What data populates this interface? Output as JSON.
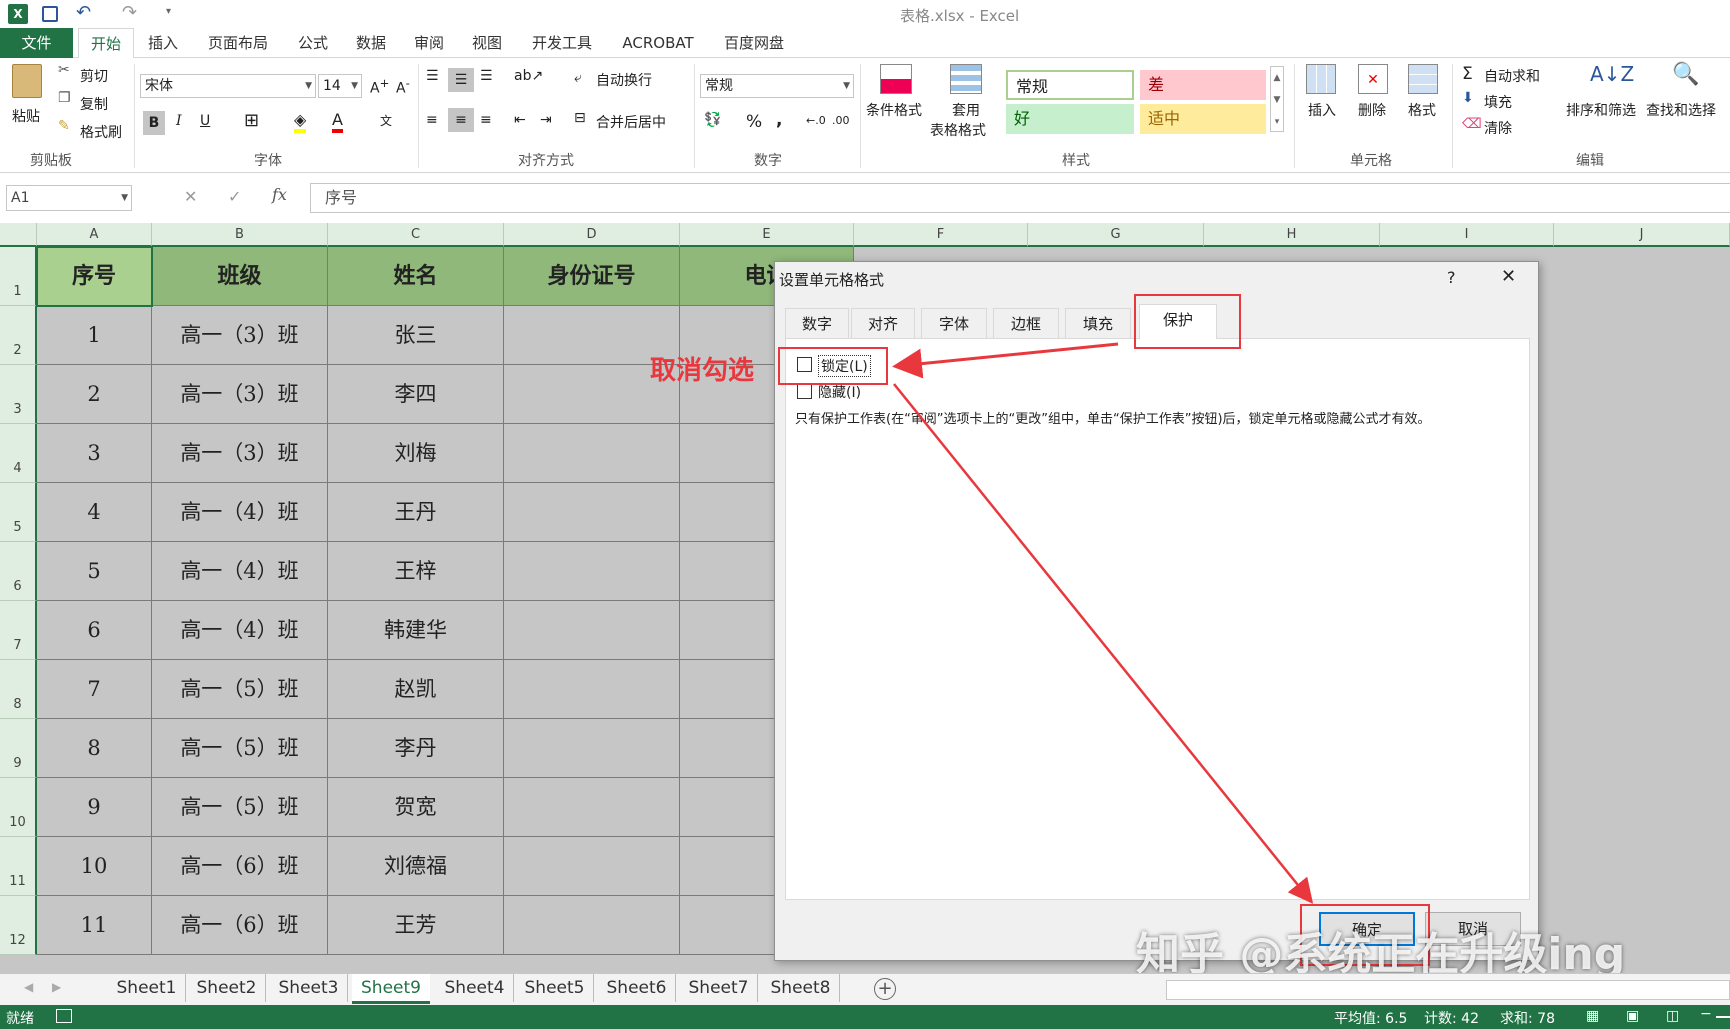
{
  "app": {
    "title": "表格.xlsx - Excel",
    "icon": "excel-icon"
  },
  "quick_access": {
    "save_icon": "save-icon",
    "undo_icon": "undo-icon",
    "redo_icon": "redo-icon"
  },
  "ribbon_tabs": [
    "文件",
    "开始",
    "插入",
    "页面布局",
    "公式",
    "数据",
    "审阅",
    "视图",
    "开发工具",
    "ACROBAT",
    "百度网盘"
  ],
  "active_tab": "开始",
  "clipboard": {
    "paste": "粘贴",
    "cut": "剪切",
    "copy": "复制",
    "format_painter": "格式刷",
    "label": "剪贴板"
  },
  "font": {
    "name": "宋体",
    "size": "14",
    "bold": "B",
    "italic": "I",
    "underline": "U",
    "label": "字体"
  },
  "alignment": {
    "wrap": "自动换行",
    "merge": "合并后居中",
    "label": "对齐方式"
  },
  "number": {
    "format": "常规",
    "percent": "%",
    "comma": ",",
    "label": "数字"
  },
  "styles": {
    "conditional": "条件格式",
    "table_format_1": "套用",
    "table_format_2": "表格格式",
    "normal": "常规",
    "bad": "差",
    "good": "好",
    "neutral": "适中",
    "label": "样式"
  },
  "cells_group": {
    "insert": "插入",
    "delete": "删除",
    "format": "格式",
    "label": "单元格"
  },
  "editing": {
    "autosum": "自动求和",
    "fill": "填充",
    "clear": "清除",
    "sort": "排序和筛选",
    "find": "查找和选择",
    "label": "编辑"
  },
  "formula_bar": {
    "name_box": "A1",
    "fx": "fx",
    "content": "序号"
  },
  "columns": [
    "A",
    "B",
    "C",
    "D",
    "E",
    "F",
    "G",
    "H",
    "I",
    "J"
  ],
  "rows": [
    "1",
    "2",
    "3",
    "4",
    "5",
    "6",
    "7",
    "8",
    "9",
    "10",
    "11",
    "12"
  ],
  "table": {
    "headers": [
      "序号",
      "班级",
      "姓名",
      "身份证号",
      "电话"
    ],
    "rows": [
      [
        "1",
        "高一（3）班",
        "张三"
      ],
      [
        "2",
        "高一（3）班",
        "李四"
      ],
      [
        "3",
        "高一（3）班",
        "刘梅"
      ],
      [
        "4",
        "高一（4）班",
        "王丹"
      ],
      [
        "5",
        "高一（4）班",
        "王梓"
      ],
      [
        "6",
        "高一（4）班",
        "韩建华"
      ],
      [
        "7",
        "高一（5）班",
        "赵凯"
      ],
      [
        "8",
        "高一（5）班",
        "李丹"
      ],
      [
        "9",
        "高一（5）班",
        "贺宽"
      ],
      [
        "10",
        "高一（6）班",
        "刘德福"
      ],
      [
        "11",
        "高一（6）班",
        "王芳"
      ]
    ]
  },
  "sheets": [
    "Sheet1",
    "Sheet2",
    "Sheet3",
    "Sheet9",
    "Sheet4",
    "Sheet5",
    "Sheet6",
    "Sheet7",
    "Sheet8"
  ],
  "active_sheet": "Sheet9",
  "status": {
    "ready": "就绪",
    "average": "平均值: 6.5",
    "count": "计数: 42",
    "sum": "求和: 78"
  },
  "dialog": {
    "title": "设置单元格格式",
    "help": "?",
    "close": "✕",
    "tabs": [
      "数字",
      "对齐",
      "字体",
      "边框",
      "填充",
      "保护"
    ],
    "active_tab": "保护",
    "locked_label": "锁定(L)",
    "locked_checked": false,
    "hidden_label": "隐藏(I)",
    "hidden_checked": false,
    "note": "只有保护工作表(在“审阅”选项卡上的“更改”组中，单击“保护工作表”按钮)后，锁定单元格或隐藏公式才有效。",
    "ok": "确定",
    "cancel": "取消"
  },
  "annotation": {
    "text": "取消勾选",
    "color": "#e8383d"
  },
  "watermark": "知乎 @系统正在升级ing"
}
